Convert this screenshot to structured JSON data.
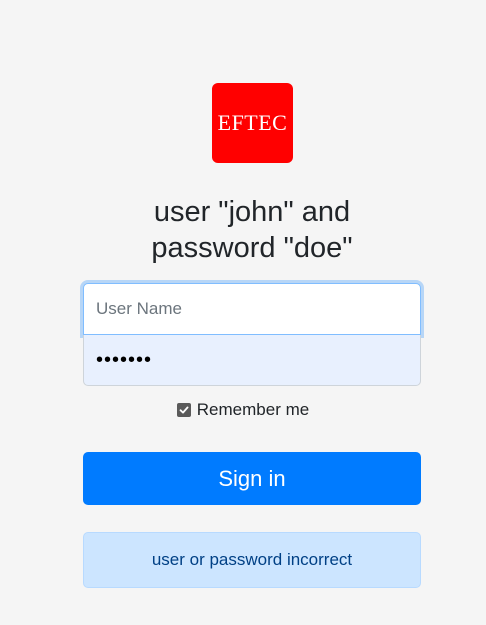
{
  "logo": {
    "text": "EFTEC",
    "color": "#ff0000"
  },
  "heading": {
    "line1": "user \"john\" and",
    "line2": "password \"doe\""
  },
  "form": {
    "username": {
      "value": "",
      "placeholder": "User Name"
    },
    "password": {
      "value": "•••••••"
    },
    "remember": {
      "label": "Remember me",
      "checked": true
    },
    "signin_label": "Sign in",
    "error_message": "user or password incorrect"
  },
  "colors": {
    "primary": "#007bff",
    "background": "#f5f5f5",
    "alert_background": "#cce5ff",
    "alert_text": "#004085"
  }
}
